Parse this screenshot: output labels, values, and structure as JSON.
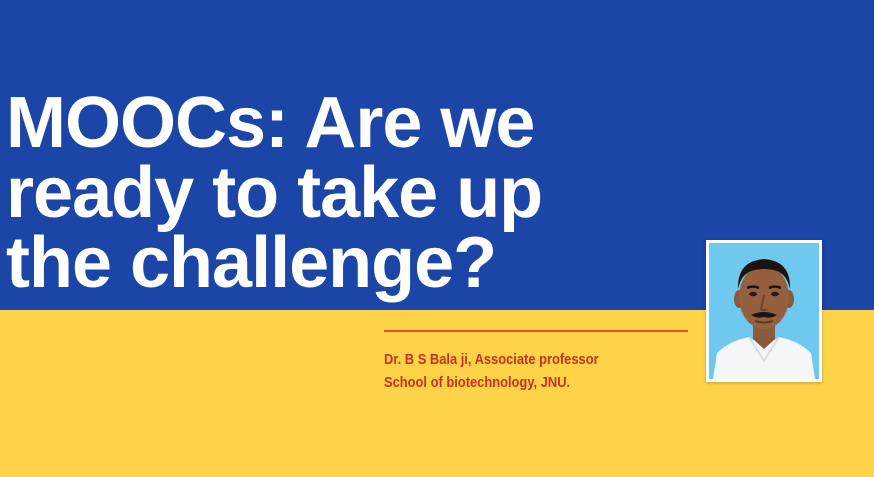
{
  "headline": {
    "lines": [
      "MOOCs: Are we",
      "ready to take up",
      "the challenge?"
    ]
  },
  "author": {
    "name_line": "Dr. B S Bala ji, Associate professor",
    "affiliation_line": "School of biotechnology, JNU."
  },
  "colors": {
    "top_band": "#1b45a6",
    "bottom_band": "#fed348",
    "headline_text": "#ffffff",
    "byline_text": "#c8321f",
    "divider": "#e8502d",
    "photo_background": "#6fc8f0"
  },
  "photo": {
    "icon": "portrait-photo"
  }
}
